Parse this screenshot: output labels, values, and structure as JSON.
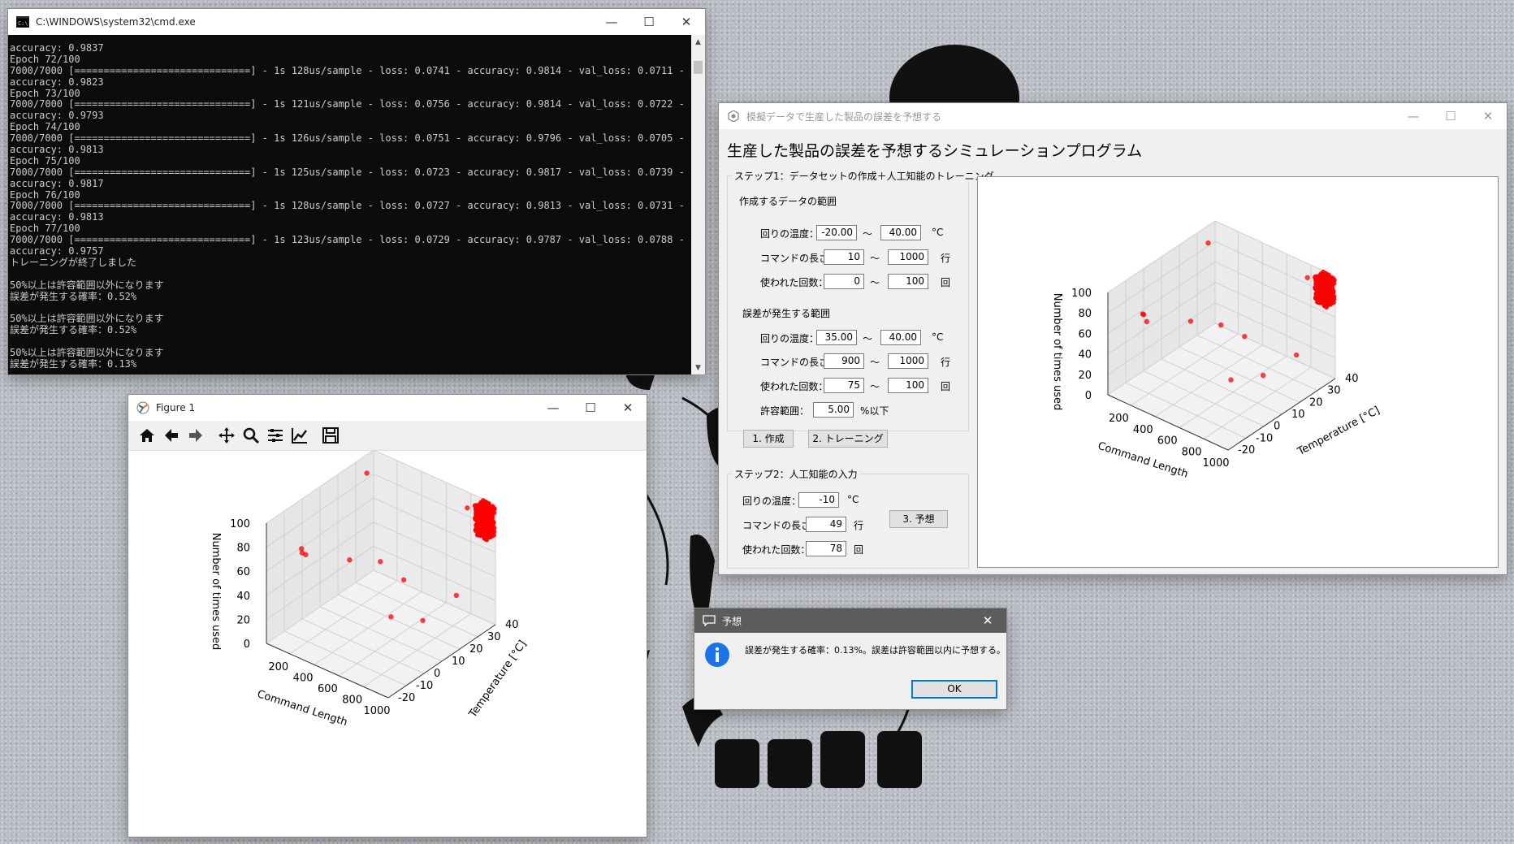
{
  "cmd": {
    "title": "C:\\WINDOWS\\system32\\cmd.exe",
    "lines": [
      "accuracy: 0.9837",
      "Epoch 72/100",
      "7000/7000 [==============================] - 1s 128us/sample - loss: 0.0741 - accuracy: 0.9814 - val_loss: 0.0711 - val_",
      "accuracy: 0.9823",
      "Epoch 73/100",
      "7000/7000 [==============================] - 1s 121us/sample - loss: 0.0756 - accuracy: 0.9814 - val_loss: 0.0722 - val_",
      "accuracy: 0.9793",
      "Epoch 74/100",
      "7000/7000 [==============================] - 1s 126us/sample - loss: 0.0751 - accuracy: 0.9796 - val_loss: 0.0705 - val_",
      "accuracy: 0.9813",
      "Epoch 75/100",
      "7000/7000 [==============================] - 1s 125us/sample - loss: 0.0723 - accuracy: 0.9817 - val_loss: 0.0739 - val_",
      "accuracy: 0.9817",
      "Epoch 76/100",
      "7000/7000 [==============================] - 1s 128us/sample - loss: 0.0727 - accuracy: 0.9813 - val_loss: 0.0731 - val_",
      "accuracy: 0.9813",
      "Epoch 77/100",
      "7000/7000 [==============================] - 1s 123us/sample - loss: 0.0729 - accuracy: 0.9787 - val_loss: 0.0788 - val_",
      "accuracy: 0.9757",
      "トレーニングが終了しました",
      "",
      "50%以上は許容範囲以外になります",
      "誤差が発生する確率：0.52%",
      "",
      "50%以上は許容範囲以外になります",
      "誤差が発生する確率：0.52%",
      "",
      "50%以上は許容範囲以外になります",
      "誤差が発生する確率：0.13%",
      "_"
    ]
  },
  "figure": {
    "title": "Figure 1",
    "toolbar_icons": [
      "home-icon",
      "back-icon",
      "forward-icon",
      "pan-icon",
      "zoom-icon",
      "subplots-icon",
      "edit-curve-icon",
      "save-icon"
    ]
  },
  "app": {
    "title": "模擬データで生産した製品の誤差を予想する",
    "heading": "生産した製品の誤差を予想するシミュレーションプログラム",
    "step1": {
      "title": "ステップ1：データセットの作成＋人工知能のトレーニング",
      "range_title": "作成するデータの範囲",
      "error_title": "誤差が発生する範囲",
      "temp_label": "回りの温度：",
      "cmd_label": "コマンドの長さ：",
      "used_label": "使われた回数：",
      "tilde": "～",
      "unit_c": "°C",
      "unit_line": "行",
      "unit_times": "回",
      "range": {
        "temp_min": "-20.00",
        "temp_max": "40.00",
        "cmd_min": "10",
        "cmd_max": "1000",
        "used_min": "0",
        "used_max": "100"
      },
      "error": {
        "temp_min": "35.00",
        "temp_max": "40.00",
        "cmd_min": "900",
        "cmd_max": "1000",
        "used_min": "75",
        "used_max": "100"
      },
      "tolerance_label": "許容範囲：",
      "tolerance_value": "5.00",
      "tolerance_unit": "%以下",
      "btn_create": "1. 作成",
      "btn_train": "2. トレーニング"
    },
    "step2": {
      "title": "ステップ2：人工知能の入力",
      "temp_label": "回りの温度：",
      "temp_value": "-10",
      "unit_c": "°C",
      "cmd_label": "コマンドの長さ：",
      "cmd_value": "49",
      "unit_line": "行",
      "used_label": "使われた回数：",
      "used_value": "78",
      "unit_times": "回",
      "btn_predict": "3. 予想"
    }
  },
  "dialog": {
    "title": "予想",
    "message": "誤差が発生する確率：0.13%。誤差は許容範囲以内に予想する。",
    "ok": "OK"
  },
  "chart_data": [
    {
      "type": "scatter",
      "xlabel": "Command Length",
      "ylabel": "Temperature [°C]",
      "zlabel": "Number of times used",
      "xticks": [
        "200",
        "400",
        "600",
        "800",
        "1000"
      ],
      "yticks": [
        "-20",
        "-10",
        "0",
        "10",
        "20",
        "30",
        "40"
      ],
      "zticks": [
        "0",
        "20",
        "40",
        "60",
        "80",
        "100"
      ],
      "xlim": [
        10,
        1000
      ],
      "ylim": [
        -20,
        40
      ],
      "zlim": [
        0,
        100
      ],
      "color": "#ff0000",
      "grid": true,
      "cluster": {
        "x": [
          900,
          1000
        ],
        "y": [
          35,
          40
        ],
        "z": [
          75,
          100
        ]
      },
      "points": [
        {
          "x": 10,
          "y": 0,
          "z": 55
        },
        {
          "x": 150,
          "y": -10,
          "z": 75
        },
        {
          "x": 100,
          "y": 30,
          "z": 95
        },
        {
          "x": 400,
          "y": 30,
          "z": 20
        },
        {
          "x": 700,
          "y": 20,
          "z": 10
        },
        {
          "x": 950,
          "y": -15,
          "z": 60
        },
        {
          "x": 800,
          "y": 38,
          "z": 90
        },
        {
          "x": 300,
          "y": -18,
          "z": 85
        },
        {
          "x": 500,
          "y": 10,
          "z": 60
        },
        {
          "x": 900,
          "y": 25,
          "z": 35
        },
        {
          "x": 250,
          "y": 10,
          "z": 50
        }
      ]
    }
  ]
}
